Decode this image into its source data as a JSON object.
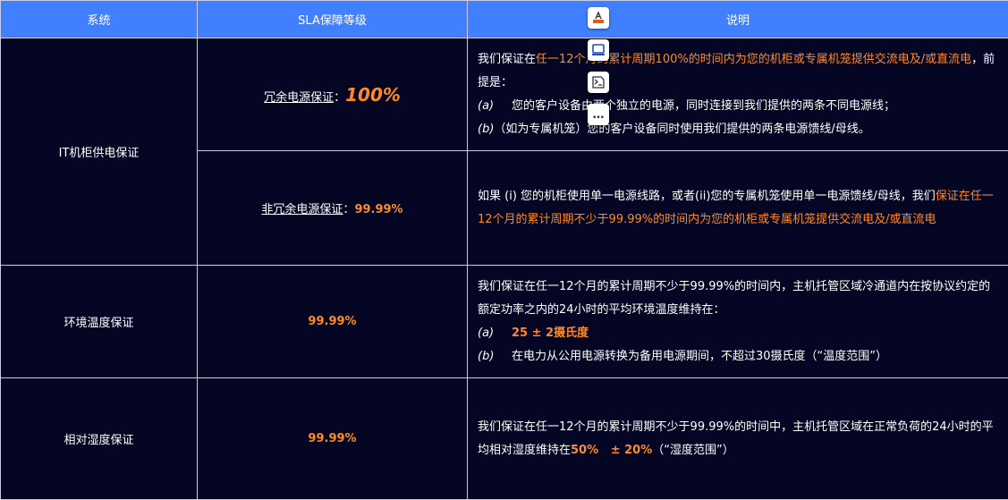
{
  "header": {
    "col_system": "系统",
    "col_level": "SLA保障等级",
    "col_desc": "说明"
  },
  "row1": {
    "system": "IT机柜供电保证",
    "redundant": {
      "label": "冗余电源保证",
      "colon": "：",
      "value": "100%",
      "desc_lead": "我们保证在",
      "desc_highlight": "任一12个月的累计周期100%的时间内为您的机柜或专属机笼提供交流电及/或直流电",
      "desc_tail": "，前提是：",
      "item_a_marker": "(a)",
      "item_a_text": "您的客户设备由两个独立的电源，同时连接到我们提供的两条不同电源线；",
      "item_b_marker": "(b)",
      "item_b_text": "（如为专属机笼）您的客户设备同时使用我们提供的两条电源馈线/母线。"
    },
    "nonredundant": {
      "label": "非冗余电源保证",
      "colon": "：",
      "value": "99.99%",
      "desc_lead": "如果 (i) 您的机柜使用单一电源线路，或者(ii)您的专属机笼使用单一电源馈线/母线，我们",
      "desc_highlight": "保证在任一12个月的累计周期不少于99.99%的时间内为您的机柜或专属机笼提供交流电及/或直流电"
    }
  },
  "row2": {
    "system": "环境温度保证",
    "value": "99.99%",
    "desc_main": "我们保证在任一12个月的累计周期不少于99.99%的时间内，主机托管区域冷通道内在按协议约定的额定功率之内的24小时的平均环境温度维持在：",
    "item_a_marker": "(a)",
    "item_a_text": "25 ± 2摄氏度",
    "item_b_marker": "(b)",
    "item_b_text": "在电力从公用电源转换为备用电源期间，不超过30摄氏度（“温度范围”）"
  },
  "row3": {
    "system": "相对湿度保证",
    "value": "99.99%",
    "desc_main": "我们保证在任一12个月的累计周期不少于99.99%的时间中，主机托管区域在正常负荷的24小时的平均相对湿度维持在",
    "desc_range": "50%   ± 20%",
    "desc_tail": "（“湿度范围”）"
  },
  "toolbar": {
    "more_label": "…"
  },
  "colors": {
    "header_bg": "#4080ff",
    "body_bg": "#050623",
    "accent": "#ff8a25",
    "border": "#c9cce4"
  },
  "icons": [
    "translate-icon",
    "screen-icon",
    "chat-icon",
    "more-icon"
  ]
}
